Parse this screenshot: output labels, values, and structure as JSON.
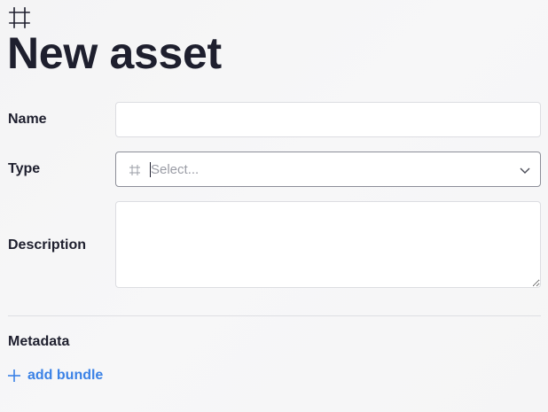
{
  "header": {
    "icon": "crop-frame-icon",
    "title": "New asset"
  },
  "form": {
    "name": {
      "label": "Name",
      "value": "",
      "placeholder": ""
    },
    "type": {
      "label": "Type",
      "icon": "crop-frame-icon",
      "placeholder": "Select...",
      "dropdown_icon": "chevron-down-icon"
    },
    "description": {
      "label": "Description",
      "value": "",
      "placeholder": ""
    }
  },
  "metadata": {
    "label": "Metadata",
    "add_bundle": {
      "icon": "plus-icon",
      "label": "add bundle"
    }
  },
  "colors": {
    "text": "#1e1f2e",
    "link": "#3b82e6",
    "border": "#dcdde1",
    "focus_border": "#8c8e98",
    "placeholder": "#9a9ca5"
  }
}
